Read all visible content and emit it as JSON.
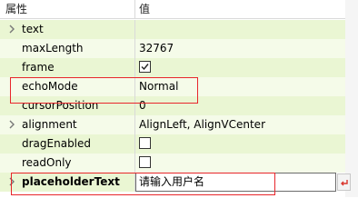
{
  "header": {
    "property_col": "属性",
    "value_col": "值"
  },
  "rows": [
    {
      "name": "text",
      "value": "",
      "expander": true
    },
    {
      "name": "maxLength",
      "value": "32767"
    },
    {
      "name": "frame",
      "value": "",
      "checkbox": true,
      "checked": true
    },
    {
      "name": "echoMode",
      "value": "Normal",
      "highlighted": true
    },
    {
      "name": "cursorPosition",
      "value": "0"
    },
    {
      "name": "alignment",
      "value": "AlignLeft, AlignVCenter",
      "expander": true
    },
    {
      "name": "dragEnabled",
      "value": "",
      "checkbox": true,
      "checked": false
    },
    {
      "name": "readOnly",
      "value": "",
      "checkbox": true,
      "checked": false
    },
    {
      "name": "placeholderText",
      "value": "请输入用户名",
      "expander": true,
      "editing": true,
      "highlighted": true
    }
  ],
  "colors": {
    "row_green": "#eaf6d3",
    "row_light": "#f5fbe9",
    "highlight_red": "#e8262b",
    "reset_arrow": "#d9342b"
  },
  "icons": {
    "expander": "chevron-right-icon",
    "checkbox_check": "checkmark-icon",
    "reset": "reset-arrow-icon"
  }
}
